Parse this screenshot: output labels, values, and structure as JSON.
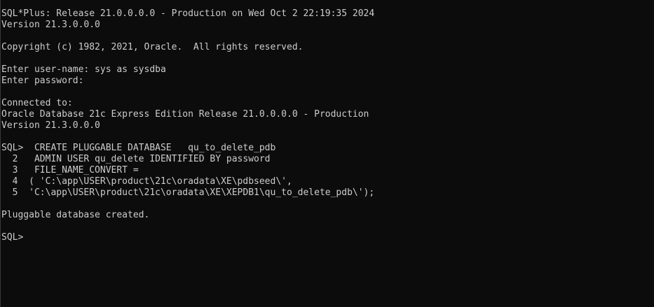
{
  "console": {
    "lines": [
      "SQL*Plus: Release 21.0.0.0.0 - Production on Wed Oct 2 22:19:35 2024",
      "Version 21.3.0.0.0",
      "",
      "Copyright (c) 1982, 2021, Oracle.  All rights reserved.",
      "",
      "Enter user-name: sys as sysdba",
      "Enter password:",
      "",
      "Connected to:",
      "Oracle Database 21c Express Edition Release 21.0.0.0.0 - Production",
      "Version 21.3.0.0.0",
      "",
      "SQL>  CREATE PLUGGABLE DATABASE   qu_to_delete_pdb",
      "  2   ADMIN USER qu_delete IDENTIFIED BY password",
      "  3   FILE_NAME_CONVERT =",
      "  4  ( 'C:\\app\\USER\\product\\21c\\oradata\\XE\\pdbseed\\',",
      "  5  'C:\\app\\USER\\product\\21c\\oradata\\XE\\XEPDB1\\qu_to_delete_pdb\\');",
      "",
      "Pluggable database created.",
      "",
      "SQL>"
    ]
  }
}
